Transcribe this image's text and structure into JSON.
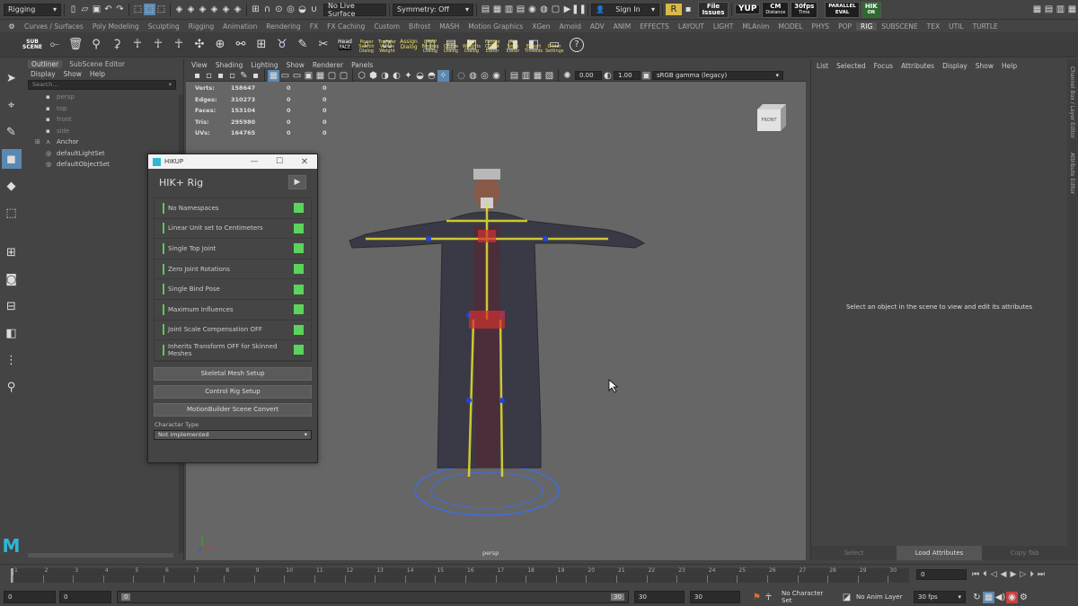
{
  "top": {
    "mode": "Rigging",
    "live_surface": "No Live Surface",
    "symmetry": "Symmetry: Off",
    "signin": "Sign In",
    "file_issues": "File Issues",
    "yup": "YUP",
    "cm": "CM",
    "cm_sub": "Distance",
    "fps": "30fps",
    "fps_sub": "Time",
    "parallel": "PARALLEL",
    "parallel_sub": "EVAL",
    "hik": "HIK",
    "hik_sub": "ON"
  },
  "shelf_tabs": [
    "Curves / Surfaces",
    "Poly Modeling",
    "Sculpting",
    "Rigging",
    "Animation",
    "Rendering",
    "FX",
    "FX Caching",
    "Custom",
    "Bifrost",
    "MASH",
    "Motion Graphics",
    "XGen",
    "Arnold",
    "ADV",
    "ANIM",
    "EFFECTS",
    "LAYOUT",
    "LIGHT",
    "MLAnim",
    "MODEL",
    "PHYS",
    "POP",
    "RIG",
    "SUBSCENE",
    "TEX",
    "UTIL",
    "TURTLE"
  ],
  "shelf_active": "RIG",
  "shelf_labels": {
    "subscene": "SUB SCENE",
    "head": "Head",
    "face": "FACE",
    "power_search": "Power Search Dialog",
    "vertex_weight": "Transfer Vertex Weight",
    "assign_dialog": "Assign Dialog",
    "cmap_binding": "CMAP Binding Dialog",
    "ct_file": "CT File Dialog",
    "skin_weights": "Skin Weights Dialog",
    "fixtool": "Fixtool CTPlat Editor",
    "ap_smth": "Ap Smth Editor",
    "export_threeds": "Export Threeds",
    "glider_settings": "Glider Settings"
  },
  "outliner": {
    "tabs": [
      "Outliner",
      "SubScene Editor"
    ],
    "menus": [
      "Display",
      "Show",
      "Help"
    ],
    "search_placeholder": "Search...",
    "items": [
      "persp",
      "top",
      "front",
      "side",
      "Anchor",
      "defaultLightSet",
      "defaultObjectSet"
    ]
  },
  "viewport": {
    "menus": [
      "View",
      "Shading",
      "Lighting",
      "Show",
      "Renderer",
      "Panels"
    ],
    "field_a": "0.00",
    "field_b": "1.00",
    "colorspace": "sRGB gamma (legacy)",
    "stats": [
      {
        "label": "Verts:",
        "v": "158647",
        "a": "0",
        "b": "0"
      },
      {
        "label": "Edges:",
        "v": "310273",
        "a": "0",
        "b": "0"
      },
      {
        "label": "Faces:",
        "v": "153104",
        "a": "0",
        "b": "0"
      },
      {
        "label": "Tris:",
        "v": "295980",
        "a": "0",
        "b": "0"
      },
      {
        "label": "UVs:",
        "v": "164765",
        "a": "0",
        "b": "0"
      }
    ],
    "view_cube": "FRONT",
    "camera": "persp"
  },
  "hikup": {
    "window_title": "HIKUP",
    "title": "HIK+ Rig",
    "checks": [
      "No Namespaces",
      "Linear Unit set to Centimeters",
      "Single Top Joint",
      "Zero Joint Rotations",
      "Single Bind Pose",
      "Maximum Influences",
      "Joint Scale Compensation OFF",
      "Inherits Transform OFF for Skinned Meshes"
    ],
    "buttons": [
      "Skeletal Mesh Setup",
      "Control Rig Setup",
      "MotionBuilder Scene Convert"
    ],
    "char_type_label": "Character Type",
    "char_type_value": "Not implemented"
  },
  "attr": {
    "menus": [
      "List",
      "Selected",
      "Focus",
      "Attributes",
      "Display",
      "Show",
      "Help"
    ],
    "message": "Select an object in the scene to view and edit its attributes",
    "buttons": [
      "Select",
      "Load Attributes",
      "Copy Tab"
    ],
    "side_tabs": [
      "Channel Box / Layer Editor",
      "Attribute Editor"
    ]
  },
  "timeline": {
    "ticks": [
      "1",
      "2",
      "3",
      "4",
      "5",
      "6",
      "7",
      "8",
      "9",
      "10",
      "11",
      "12",
      "13",
      "14",
      "15",
      "16",
      "17",
      "18",
      "19",
      "20",
      "21",
      "22",
      "23",
      "24",
      "25",
      "26",
      "27",
      "28",
      "29",
      "30"
    ],
    "current": "0"
  },
  "range": {
    "start": "0",
    "anim_start": "0",
    "slider_start": "0",
    "slider_end": "30",
    "anim_end": "30",
    "end": "30",
    "no_char": "No Character Set",
    "no_anim": "No Anim Layer",
    "fps": "30 fps"
  }
}
